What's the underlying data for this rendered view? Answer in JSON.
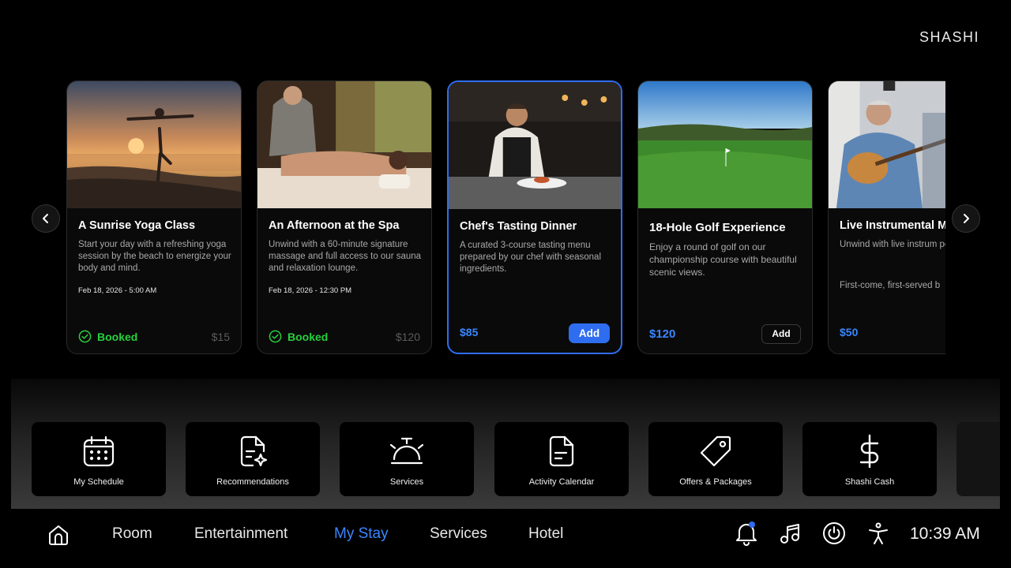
{
  "brand": "SHASHI",
  "carousel": {
    "cards": [
      {
        "title": "A Sunrise Yoga Class",
        "description": "Start your day with a refreshing yoga session by the beach to energize your body and mind.",
        "date": "Feb 18, 2026 - 5:00 AM",
        "status": "Booked",
        "price": "$15"
      },
      {
        "title": "An Afternoon at the Spa",
        "description": "Unwind with a 60-minute signature massage and full access to our sauna and relaxation lounge.",
        "date": "Feb 18, 2026 - 12:30 PM",
        "status": "Booked",
        "price": "$120"
      },
      {
        "title": "Chef's Tasting Dinner",
        "description": "A curated 3-course tasting menu prepared by our chef with seasonal ingredients.",
        "price": "$85",
        "action": "Add"
      },
      {
        "title": "18-Hole Golf Experience",
        "description": "Enjoy a round of golf on our championship course with beautiful scenic views.",
        "price": "$120",
        "action": "Add"
      },
      {
        "title": "Live Instrumental M",
        "description": "Unwind with live instrum performances by talente musicians in The Emerald",
        "note": "First-come, first-served b",
        "price": "$50"
      }
    ]
  },
  "quick_tiles": [
    {
      "label": "My Schedule",
      "icon": "calendar-icon"
    },
    {
      "label": "Recommendations",
      "icon": "document-star-icon"
    },
    {
      "label": "Services",
      "icon": "service-bell-icon"
    },
    {
      "label": "Activity Calendar",
      "icon": "document-icon"
    },
    {
      "label": "Offers & Packages",
      "icon": "tag-icon"
    },
    {
      "label": "Shashi Cash",
      "icon": "dollar-icon"
    }
  ],
  "navbar": {
    "items": [
      "Room",
      "Entertainment",
      "My Stay",
      "Services",
      "Hotel"
    ],
    "active": "My Stay",
    "time": "10:39 AM"
  },
  "colors": {
    "accent": "#2f6df0",
    "price": "#3a86ff",
    "booked": "#27d03e"
  }
}
